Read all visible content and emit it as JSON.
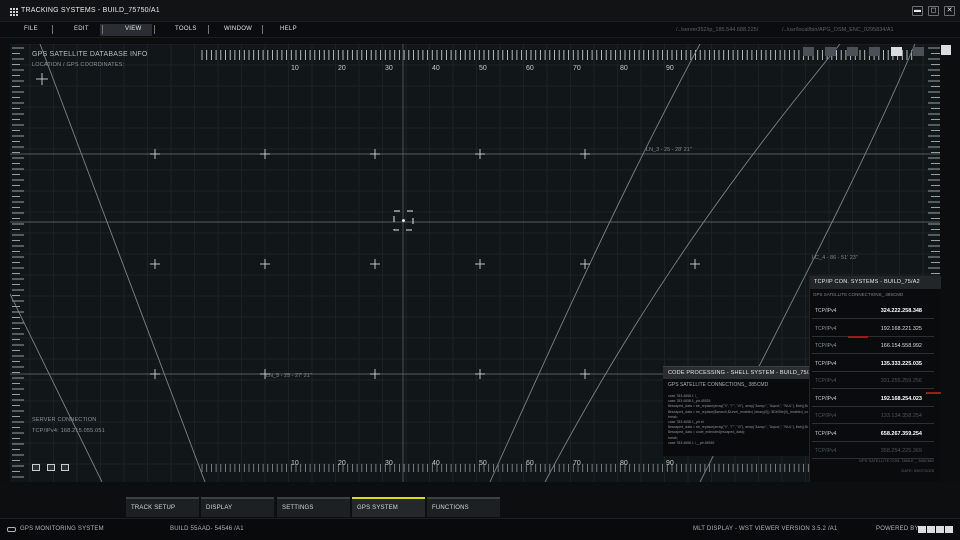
{
  "window": {
    "title": "TRACKING SYSTEMS - BUILD_75750/A1",
    "controls": {
      "minimize": "▬",
      "restore": "◻",
      "close": "✕"
    }
  },
  "menu": {
    "items": [
      "FILE",
      "EDIT",
      "VIEW",
      "TOOLS",
      "WINDOW",
      "HELP"
    ],
    "active": "VIEW",
    "path_left": "/../server352/ip_185.544.688.225/",
    "path_right": "/../usr/local/bin/APG_OSM_ENC_0295834/A1"
  },
  "viewport": {
    "panel_title": "GPS SATELLITE DATABASE INFO",
    "location_label": "LOCATION / GPS COORDINATES:",
    "server_connection": "SERVER CONNECTION",
    "server_tcp": "TCP/IPv4: 168.215.055.051",
    "ruler_labels": [
      "10",
      "20",
      "30",
      "40",
      "50",
      "60",
      "70",
      "80",
      "90"
    ],
    "line_labels": {
      "ln3": "LN_3 - 25 - 28' 21\"",
      "ln5": "LN_5 - 25 - 27' 21\"",
      "lc4": "LC_4 - 86 - 51' 23\""
    }
  },
  "code_panel": {
    "title": "CODE PROCESSING - SHELL SYSTEM - BUILD_75/A2",
    "subtitle": "GPS SATELLITE CONNECTIONS_ 385CMD",
    "lines": [
      "case 783:4658.1 /_",
      "case 783:4658.1_ptr.45535",
      "$escaped_data = str_replace(array(\"\\\\\", \"\\\"\", \"\\0\"), array(\"&amp;\", \"&quot;\", \"NUL\"), $str));$val",
      "$escaped_data = str_replace($search,$Level_enabled_binary(0)); $DbSite(0)_enabled_code = ?",
      "break;",
      "case 783:4658.1_ptr id",
      "$escaped_data = str_replace(array(\"\\\\\", \"\\\"\", \"\\0\"), array(\"&amp;\", \"&quot;\", \"NUL\"), $str));$val",
      "$escaped_data = code_extended(escaped_data);",
      "break;",
      "case 783:4658.1 /__ptr.45535"
    ]
  },
  "tcp_panel": {
    "title": "TCP/IP CON. SYSTEMS - BUILD_75/A2",
    "subtitle": "GPS SATELLITE CONNECTIONS_ 385CMD",
    "rows": [
      {
        "proto": "TCP/IPv4",
        "ip": "324.222.258.348",
        "state": "bright"
      },
      {
        "proto": "TCP/IPv4",
        "ip": "192.168.221.325",
        "state": "normal"
      },
      {
        "proto": "TCP/IPv4",
        "ip": "166.154.558.992",
        "state": "normal"
      },
      {
        "proto": "TCP/IPv4",
        "ip": "135.333.225.035",
        "state": "bright"
      },
      {
        "proto": "TCP/IPv4",
        "ip": "331.255.259.256",
        "state": "dim"
      },
      {
        "proto": "TCP/IPv4",
        "ip": "192.168.254.023",
        "state": "bright"
      },
      {
        "proto": "TCP/IPv4",
        "ip": "133.134.358.254",
        "state": "dim"
      },
      {
        "proto": "TCP/IPv4",
        "ip": "658.267.359.254",
        "state": "bright"
      },
      {
        "proto": "TCP/IPv4",
        "ip": "358.254.225.369",
        "state": "dim"
      }
    ],
    "footer1": "GPS SATELLITE CON. TABLE _ 385CMD",
    "footer2": "DATE: 05/07/2025",
    "accent": "#a11a1a"
  },
  "tabs": {
    "items": [
      "TRACK SETUP",
      "DISPLAY",
      "SETTINGS",
      "GPS SYSTEM",
      "FUNCTIONS"
    ],
    "active": "GPS SYSTEM",
    "active_color": "#d7dd1a"
  },
  "status": {
    "system": "GPS MONITORING SYSTEM",
    "build": "BUILD 55AAD- 54546 /A1",
    "version": "MLT DISPLAY - WST VIEWER  VERSION 3.5.2 /A1",
    "powered_by": "POWERED BY"
  }
}
